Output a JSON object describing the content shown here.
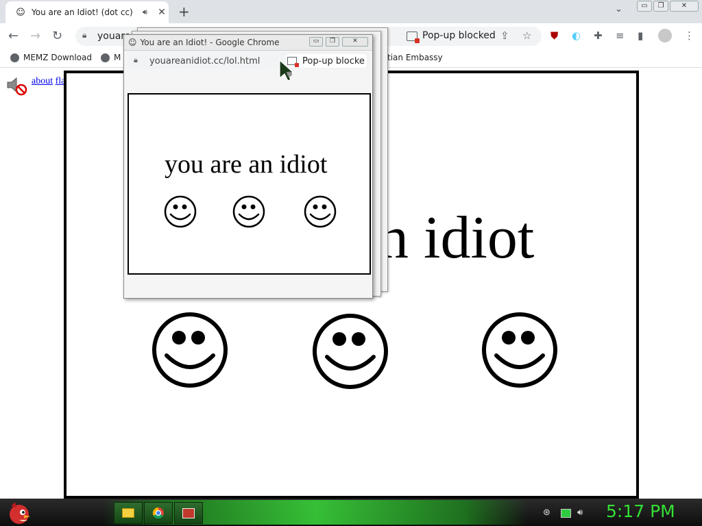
{
  "tab": {
    "title": "You are an Idiot! (dot cc)",
    "favicon": "smiley-icon",
    "audio_icon": "speaker-icon"
  },
  "window_controls": {
    "minimize": "▭",
    "restore": "❐",
    "close": "✕"
  },
  "toolbar": {
    "url": "youare",
    "popup_blocked": "Pop-up blocked"
  },
  "bookmarks": [
    {
      "label": "MEMZ Download"
    },
    {
      "label": "M"
    },
    {
      "label": "tian Embassy"
    }
  ],
  "page": {
    "links": [
      "about",
      "flash"
    ],
    "big_text": "n idiot",
    "smileys": 3
  },
  "popup": {
    "title": "You are an Idiot! - Google Chrome",
    "url": "youareanidiot.cc/lol.html",
    "blocked": "Pop-up blocke",
    "text": "you are an idiot"
  },
  "taskbar": {
    "clock": "5:17 PM",
    "buttons": [
      "folder-icon",
      "chrome-icon",
      "app-icon"
    ]
  },
  "colors": {
    "clock": "#34e034",
    "taskbar_accent": "#39d139",
    "link": "#0000ee"
  }
}
